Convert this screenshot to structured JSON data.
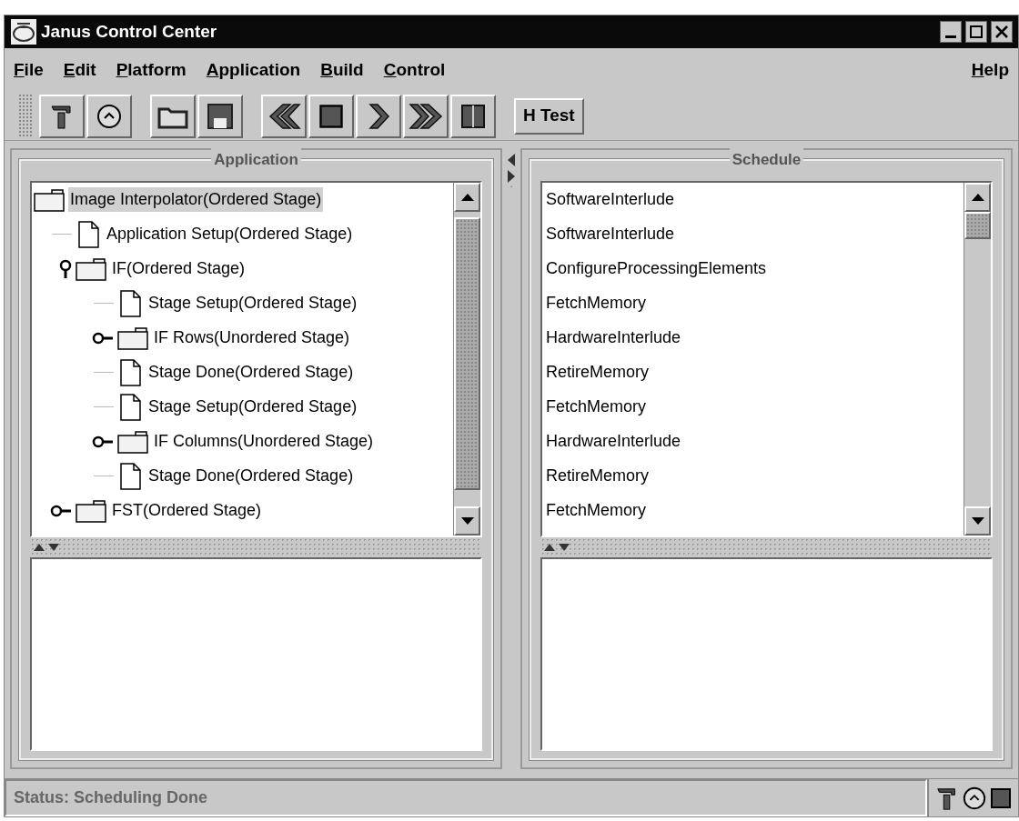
{
  "window": {
    "title": "Janus Control Center"
  },
  "menu": {
    "items": [
      {
        "label": "File"
      },
      {
        "label": "Edit"
      },
      {
        "label": "Platform"
      },
      {
        "label": "Application"
      },
      {
        "label": "Build"
      },
      {
        "label": "Control"
      }
    ],
    "help": {
      "label": "Help"
    }
  },
  "toolbar": {
    "test_button": "H Test"
  },
  "application": {
    "title": "Application",
    "tree": [
      {
        "label": "Image Interpolator(Ordered Stage)",
        "kind": "folder",
        "selected": true,
        "children": [
          {
            "label": "Application Setup(Ordered Stage)",
            "kind": "document",
            "selected": false
          },
          {
            "label": "IF(Ordered Stage)",
            "kind": "folder",
            "selected": false,
            "expanded": true,
            "children": [
              {
                "label": "Stage Setup(Ordered Stage)",
                "kind": "document",
                "selected": false
              },
              {
                "label": "IF Rows(Unordered Stage)",
                "kind": "folder",
                "selected": false,
                "expanded": false
              },
              {
                "label": "Stage Done(Ordered Stage)",
                "kind": "document",
                "selected": false
              },
              {
                "label": "Stage Setup(Ordered Stage)",
                "kind": "document",
                "selected": false
              },
              {
                "label": "IF Columns(Unordered Stage)",
                "kind": "folder",
                "selected": false,
                "expanded": false
              },
              {
                "label": "Stage Done(Ordered Stage)",
                "kind": "document",
                "selected": false
              }
            ]
          },
          {
            "label": "FST(Ordered Stage)",
            "kind": "folder",
            "selected": false,
            "expanded": false
          }
        ]
      }
    ]
  },
  "schedule": {
    "title": "Schedule",
    "items": [
      "SoftwareInterlude",
      "SoftwareInterlude",
      "ConfigureProcessingElements",
      "FetchMemory",
      "HardwareInterlude",
      "RetireMemory",
      "FetchMemory",
      "HardwareInterlude",
      "RetireMemory",
      "FetchMemory"
    ]
  },
  "status_bar": {
    "text": "Status: Scheduling Done"
  }
}
